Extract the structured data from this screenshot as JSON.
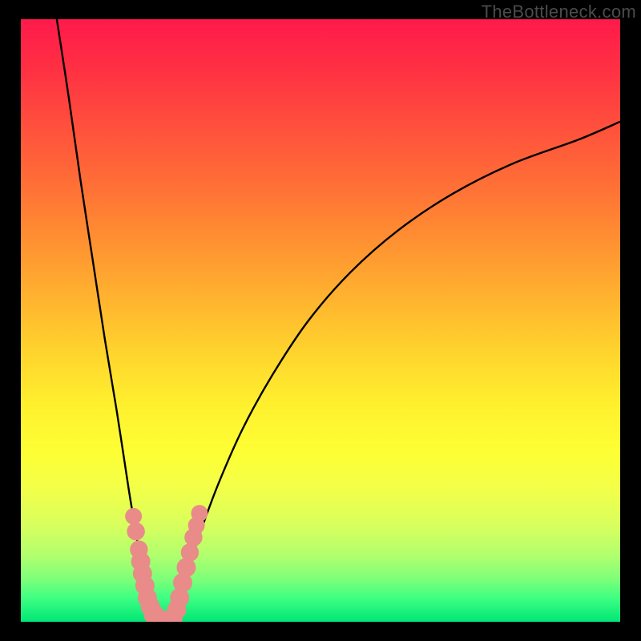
{
  "watermark": "TheBottleneck.com",
  "chart_data": {
    "type": "line",
    "title": "",
    "xlabel": "",
    "ylabel": "",
    "xlim": [
      0,
      100
    ],
    "ylim": [
      0,
      100
    ],
    "grid": false,
    "series": [
      {
        "name": "left-branch",
        "x": [
          6,
          8,
          10,
          12,
          14,
          16,
          18,
          19,
          20,
          21,
          22,
          23
        ],
        "y": [
          100,
          87,
          73,
          60,
          47,
          35,
          22,
          16,
          10,
          5,
          2,
          0
        ]
      },
      {
        "name": "right-branch",
        "x": [
          25,
          26,
          27,
          28,
          30,
          33,
          37,
          42,
          48,
          55,
          63,
          72,
          82,
          93,
          100
        ],
        "y": [
          0,
          2,
          5,
          9,
          15,
          23,
          32,
          41,
          50,
          58,
          65,
          71,
          76,
          80,
          83
        ]
      }
    ],
    "markers": {
      "name": "highlight-dots",
      "color": "#e98b88",
      "points": [
        {
          "x": 18.8,
          "y": 17.5,
          "r": 1.4
        },
        {
          "x": 19.2,
          "y": 15.0,
          "r": 1.5
        },
        {
          "x": 19.7,
          "y": 12.0,
          "r": 1.5
        },
        {
          "x": 20.0,
          "y": 10.0,
          "r": 1.6
        },
        {
          "x": 20.3,
          "y": 8.0,
          "r": 1.6
        },
        {
          "x": 20.7,
          "y": 6.0,
          "r": 1.6
        },
        {
          "x": 21.1,
          "y": 4.0,
          "r": 1.6
        },
        {
          "x": 21.6,
          "y": 2.5,
          "r": 1.6
        },
        {
          "x": 22.2,
          "y": 1.2,
          "r": 1.7
        },
        {
          "x": 23.0,
          "y": 0.4,
          "r": 1.7
        },
        {
          "x": 23.8,
          "y": 0.1,
          "r": 1.7
        },
        {
          "x": 24.6,
          "y": 0.2,
          "r": 1.7
        },
        {
          "x": 25.4,
          "y": 0.7,
          "r": 1.6
        },
        {
          "x": 26.0,
          "y": 2.0,
          "r": 1.6
        },
        {
          "x": 26.5,
          "y": 4.0,
          "r": 1.6
        },
        {
          "x": 27.0,
          "y": 6.5,
          "r": 1.6
        },
        {
          "x": 27.6,
          "y": 9.0,
          "r": 1.6
        },
        {
          "x": 28.2,
          "y": 11.5,
          "r": 1.5
        },
        {
          "x": 28.8,
          "y": 14.0,
          "r": 1.5
        },
        {
          "x": 29.3,
          "y": 16.0,
          "r": 1.4
        },
        {
          "x": 29.8,
          "y": 18.0,
          "r": 1.4
        }
      ]
    }
  }
}
